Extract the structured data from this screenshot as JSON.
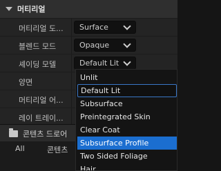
{
  "section": {
    "title": "머티리얼"
  },
  "rows": [
    {
      "label": "머티리얼 도...",
      "value": "Surface"
    },
    {
      "label": "블렌드 모드",
      "value": "Opaque"
    },
    {
      "label": "셰이딩 모델",
      "value": "Default Lit"
    },
    {
      "label": "양면"
    },
    {
      "label": "머티리얼 어..."
    },
    {
      "label": "레이 트레이..."
    }
  ],
  "dropdown": {
    "options": [
      "Unlit",
      "Default Lit",
      "Subsurface",
      "Preintegrated Skin",
      "Clear Coat",
      "Subsurface Profile",
      "Two Sided Foliage",
      "Hair"
    ],
    "selected": "Default Lit",
    "hovered": "Subsurface Profile"
  },
  "content_drawer": {
    "label": "콘텐츠 드로어"
  },
  "bottom": {
    "all_label": "All",
    "tab_label": "콘텐츠"
  },
  "colors": {
    "accent": "#1b6ed0",
    "selected_border": "#3a77c7",
    "panel_bg": "#242424"
  },
  "icons": {
    "collapse": "triangle-down-icon",
    "combo": "chevron-down-icon",
    "folder": "folder-icon"
  }
}
